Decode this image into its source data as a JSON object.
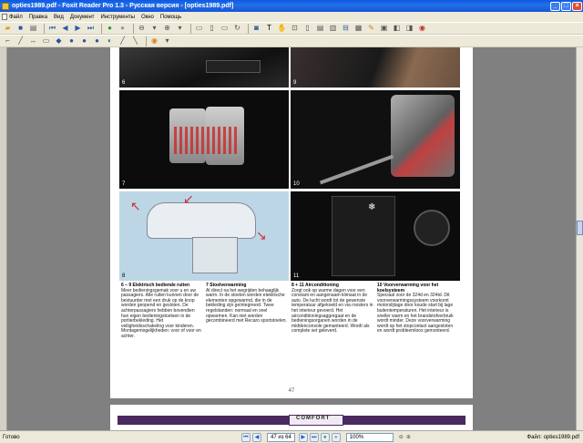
{
  "window": {
    "title": "opties1989.pdf - Foxit Reader Pro 1.3 - Русская версия - [opties1989.pdf]"
  },
  "menu": {
    "items": [
      "Файл",
      "Правка",
      "Вид",
      "Документ",
      "Инструменты",
      "Окно",
      "Помощь"
    ]
  },
  "page": {
    "photo_numbers": [
      "6",
      "9",
      "7",
      "10",
      "8",
      "11"
    ],
    "captions": [
      {
        "title": "6 – 9 Elektrisch bediende ruiten",
        "body": "Meer bedieningsgemak voor u en uw passagiers. Alle ruiten kunnen door de bestuurder met een druk op de knop worden geopend en gesloten. De achterpassagiers heb­ben bovendien hun eigen bedie­ningstoetsen in de portierbekleding. Het veiligheidsschakeling voor kin­deren. Montagemogelijkheden: voor of voor en achter."
      },
      {
        "title": "7 Stoelverwarming",
        "body": "Al direct na het wegrijden behaag­lijk warm. In de stoelen worden elektrische elementen opgewarmd, die in de bekleding zijn geïnte­greerd. Twee regelstanden: nor­maal en snel opwarmen. Kan niet worden gecombineerd met Recaro sportstoelen."
      },
      {
        "title": "8 + 11 Airconditioning",
        "body": "Zorgt ook op warme dagen voor een constant en aangenaam kli­maat in de auto. De lucht wordt tot de gewenste temperatuur afge­koeld en via roosters in het interieur gevoerd. Het airconditioningsaggre­gaat en de bedieningsorganen wor­den in de middenconsole geman­teerd. Wordt als complete set geleverd."
      },
      {
        "title": "10 Voorverwarming voor het koelsysteem",
        "body": "Speciaal voor de 324d en 324td. Dit voorverwarmingssysteem voor­komt motorslijtage door koude start bij lage buitentemperaturen. Het in­terieur is sneller warm en het brandstofverbruik wordt minder. Deze voorverwarming wordt op het stopcontact aangesloten en wordt probleemloos gemonteerd."
      }
    ],
    "page_number": "47",
    "next_heading": "COMFORT"
  },
  "status": {
    "ready": "Готово",
    "page_display": "47 из 64",
    "zoom": "100%",
    "file": "Файл: opties1989.pdf"
  },
  "colors": {
    "titlebar": "#0a5ae0",
    "accent_red": "#c03030"
  }
}
